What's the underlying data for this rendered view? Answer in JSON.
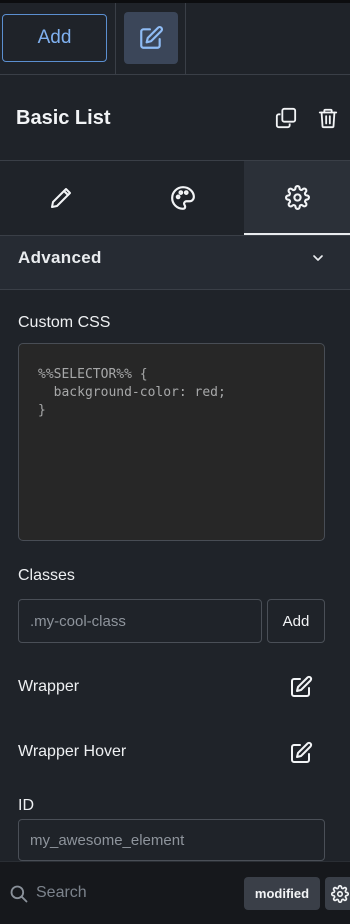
{
  "toolbar": {
    "add_label": "Add"
  },
  "panel": {
    "title": "Basic List"
  },
  "tabs": [
    {
      "name": "Content",
      "icon": "pencil-icon"
    },
    {
      "name": "Design",
      "icon": "palette-icon"
    },
    {
      "name": "Advanced",
      "icon": "gear-icon",
      "active": true
    }
  ],
  "advanced": {
    "section_title": "Advanced",
    "custom_css_label": "Custom CSS",
    "custom_css_code": "%%SELECTOR%% {\n  background-color: red;\n}",
    "classes_label": "Classes",
    "classes_placeholder": ".my-cool-class",
    "classes_add_label": "Add",
    "wrapper_label": "Wrapper",
    "wrapper_hover_label": "Wrapper Hover",
    "id_label": "ID",
    "id_placeholder": "my_awesome_element"
  },
  "footer": {
    "search_placeholder": "Search",
    "status_badge": "modified"
  },
  "colors": {
    "background": "#1f2329",
    "accent": "#7fb0ef",
    "active_button": "#3b4659"
  }
}
